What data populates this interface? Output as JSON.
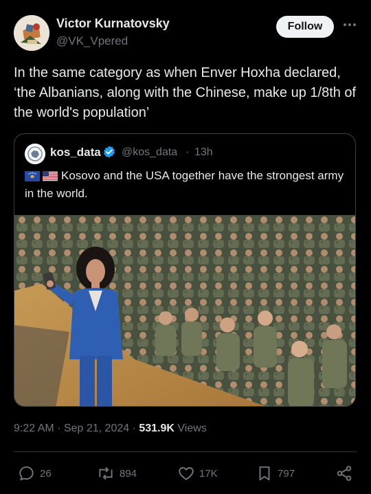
{
  "author": {
    "name": "Victor Kurnatovsky",
    "handle": "@VK_Vpered",
    "follow_label": "Follow"
  },
  "post": {
    "text": "In the same category as when Enver Hoxha declared, ‘the Albanians, along with the Chinese, make up 1/8th of the world's population’"
  },
  "quote": {
    "name": "kos_data",
    "handle": "@kos_data",
    "separator": "·",
    "time": "13h",
    "text": "Kosovo and the USA together have the strongest army in the world."
  },
  "meta": {
    "time": "9:22 AM",
    "date": "Sep 21, 2024",
    "views_count": "531.9K",
    "views_label": "Views"
  },
  "actions": {
    "replies": "26",
    "reposts": "894",
    "likes": "17K",
    "bookmarks": "797"
  },
  "colors": {
    "background": "#000000",
    "text": "#e7e9ea",
    "secondary": "#71767b",
    "verified": "#1d9bf0"
  }
}
